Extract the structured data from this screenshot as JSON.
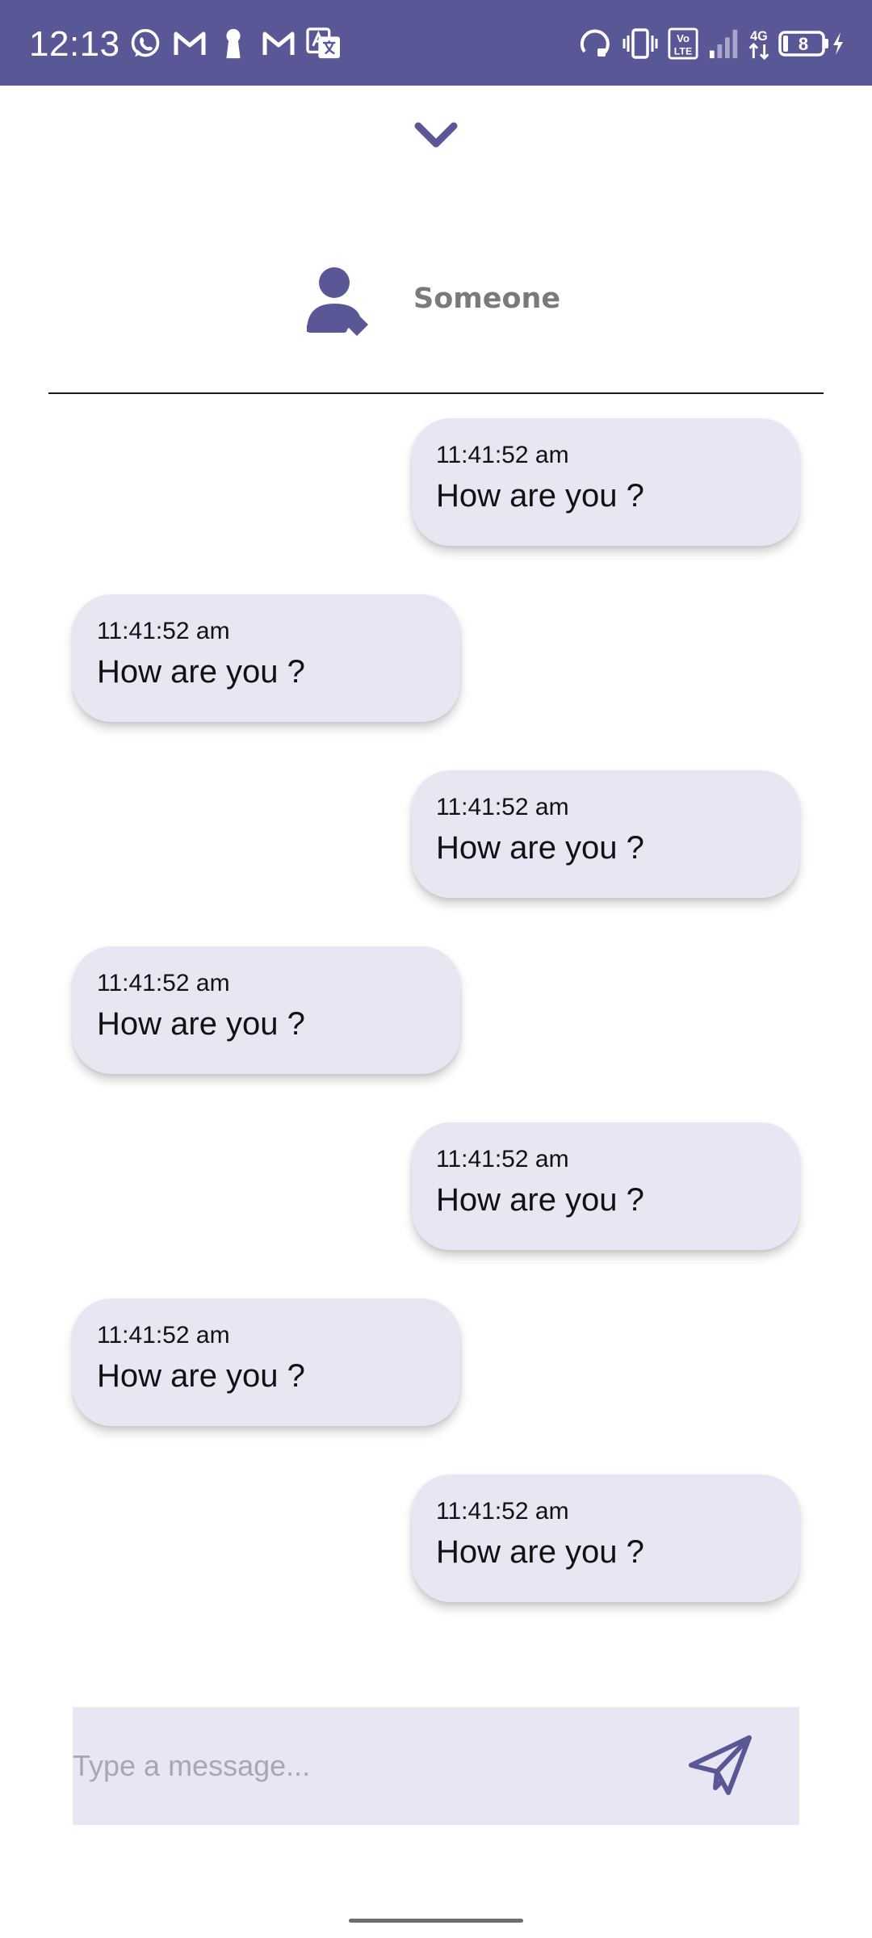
{
  "status_bar": {
    "time": "12:13",
    "battery_level": "8",
    "network_label": "4G",
    "left_icons": [
      "whatsapp-icon",
      "gmail-icon",
      "keyhole-icon",
      "gmail-icon",
      "translate-icon"
    ],
    "right_icons": [
      "headset-icon",
      "vibrate-icon",
      "volte-icon",
      "signal-icon",
      "network-4g-icon",
      "battery-icon",
      "charging-icon"
    ]
  },
  "header": {
    "collapse_icon": "chevron-down-icon",
    "contact_name": "Someone",
    "avatar_icon": "person-edit-icon"
  },
  "messages": [
    {
      "direction": "sent",
      "time": "11:41:52 am",
      "text": "How are you ?"
    },
    {
      "direction": "received",
      "time": "11:41:52 am",
      "text": "How are you ?"
    },
    {
      "direction": "sent",
      "time": "11:41:52 am",
      "text": "How are you ?"
    },
    {
      "direction": "received",
      "time": "11:41:52 am",
      "text": "How are you ?"
    },
    {
      "direction": "sent",
      "time": "11:41:52 am",
      "text": "How are you ?"
    },
    {
      "direction": "received",
      "time": "11:41:52 am",
      "text": "How are you ?"
    },
    {
      "direction": "sent",
      "time": "11:41:52 am",
      "text": "How are you ?"
    }
  ],
  "composer": {
    "value": "",
    "placeholder": "Type a message...",
    "send_icon": "send-icon"
  },
  "colors": {
    "primary": "#5a5797",
    "bubble": "#e9e6f4",
    "composer": "#e9e6f4",
    "name_text": "#7a7a7a"
  }
}
